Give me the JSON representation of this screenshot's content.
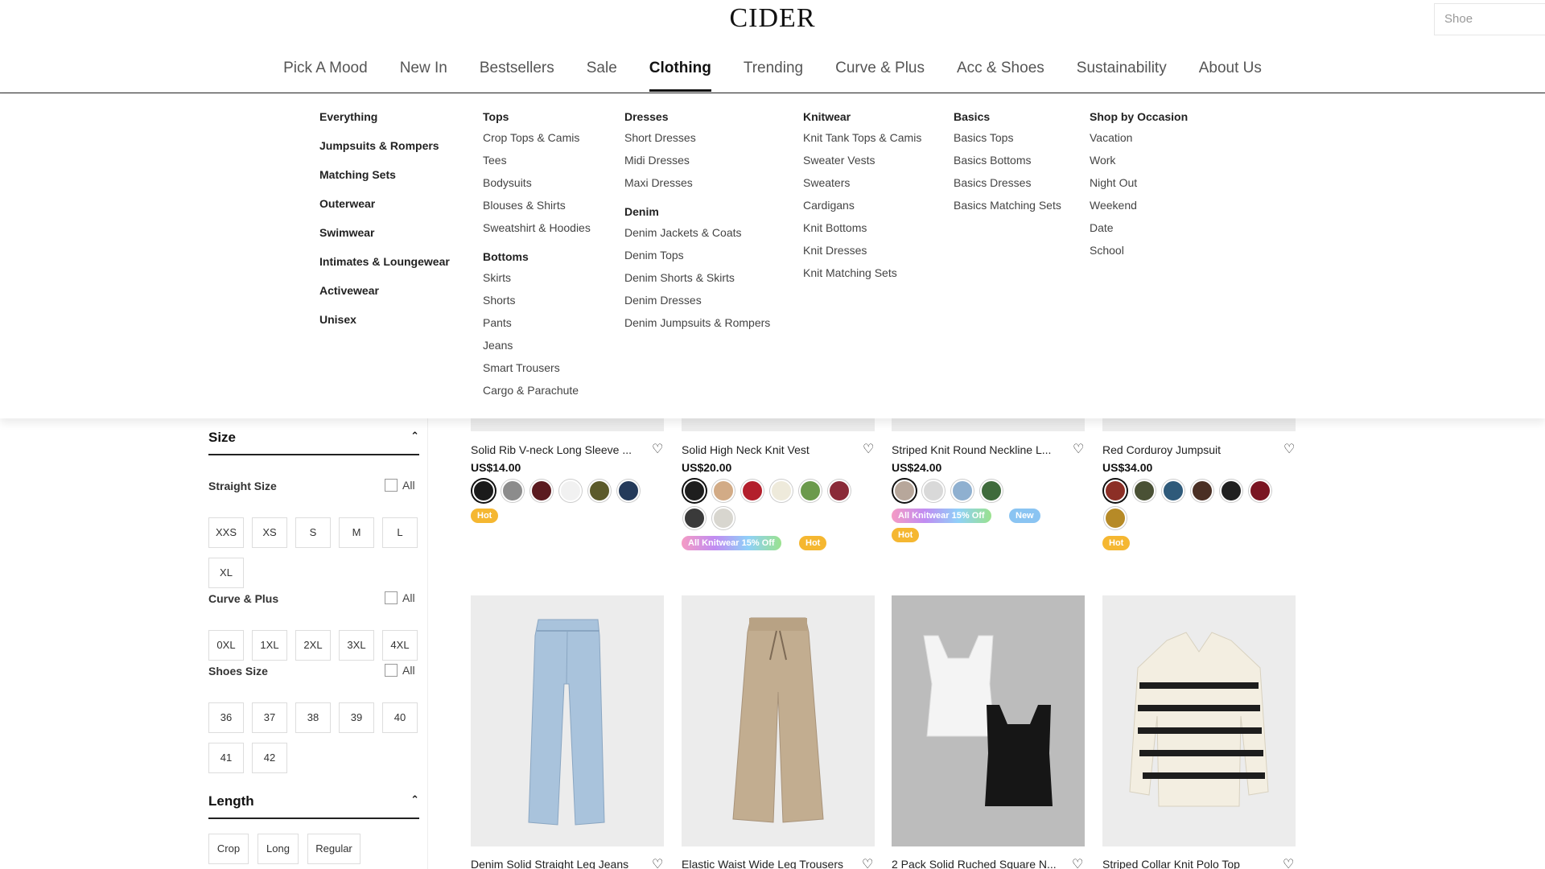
{
  "header": {
    "logo": "CIDER",
    "search_placeholder": "Shoe"
  },
  "nav": [
    {
      "label": "Pick A Mood"
    },
    {
      "label": "New In"
    },
    {
      "label": "Bestsellers"
    },
    {
      "label": "Sale"
    },
    {
      "label": "Clothing",
      "active": true
    },
    {
      "label": "Trending"
    },
    {
      "label": "Curve & Plus"
    },
    {
      "label": "Acc & Shoes"
    },
    {
      "label": "Sustainability"
    },
    {
      "label": "About Us"
    }
  ],
  "mega": {
    "main_links": [
      "Everything",
      "Jumpsuits & Rompers",
      "Matching Sets",
      "Outerwear",
      "Swimwear",
      "Intimates & Loungewear",
      "Activewear",
      "Unisex"
    ],
    "tops": {
      "title": "Tops",
      "items": [
        "Crop Tops & Camis",
        "Tees",
        "Bodysuits",
        "Blouses & Shirts",
        "Sweatshirt & Hoodies"
      ]
    },
    "bottoms": {
      "title": "Bottoms",
      "items": [
        "Skirts",
        "Shorts",
        "Pants",
        "Jeans",
        "Smart Trousers",
        "Cargo & Parachute"
      ]
    },
    "dresses": {
      "title": "Dresses",
      "items": [
        "Short Dresses",
        "Midi Dresses",
        "Maxi Dresses"
      ]
    },
    "denim": {
      "title": "Denim",
      "items": [
        "Denim Jackets & Coats",
        "Denim Tops",
        "Denim Shorts & Skirts",
        "Denim Dresses",
        "Denim Jumpsuits & Rompers"
      ]
    },
    "knitwear": {
      "title": "Knitwear",
      "items": [
        "Knit Tank Tops & Camis",
        "Sweater Vests",
        "Sweaters",
        "Cardigans",
        "Knit Bottoms",
        "Knit Dresses",
        "Knit Matching Sets"
      ]
    },
    "basics": {
      "title": "Basics",
      "items": [
        "Basics Tops",
        "Basics Bottoms",
        "Basics Dresses",
        "Basics Matching Sets"
      ]
    },
    "occasion": {
      "title": "Shop by Occasion",
      "items": [
        "Vacation",
        "Work",
        "Night Out",
        "Weekend",
        "Date",
        "School"
      ]
    }
  },
  "filters": {
    "size_title": "Size",
    "straight_label": "Straight Size",
    "straight_sizes": [
      "XXS",
      "XS",
      "S",
      "M",
      "L",
      "XL"
    ],
    "curve_label": "Curve & Plus",
    "curve_sizes": [
      "0XL",
      "1XL",
      "2XL",
      "3XL",
      "4XL"
    ],
    "shoes_label": "Shoes Size",
    "shoe_sizes": [
      "36",
      "37",
      "38",
      "39",
      "40",
      "41",
      "42"
    ],
    "all_label": "All",
    "length_title": "Length",
    "lengths": [
      "Crop",
      "Long",
      "Regular"
    ],
    "caret": "⌃"
  },
  "products_row1": [
    {
      "title": "Solid Rib V-neck Long Sleeve ...",
      "price": "US$14.00",
      "swatches": [
        "#1b1b1b",
        "#8c8c8c",
        "#5a1a1f",
        "#f1f1f1",
        "#5b5a2a",
        "#243a5a"
      ],
      "badges": [
        {
          "type": "hot",
          "text": "Hot"
        }
      ]
    },
    {
      "title": "Solid High Neck Knit Vest",
      "price": "US$20.00",
      "swatches": [
        "#1e1e1e",
        "#d2ab86",
        "#b31f2c",
        "#eeeadb",
        "#6b9a4c",
        "#8a2a38",
        "#3a3a3a",
        "#d8d6cf"
      ],
      "badges": [
        {
          "type": "knit",
          "text": "All Knitwear 15% Off"
        },
        {
          "type": "hot",
          "text": "Hot"
        }
      ]
    },
    {
      "title": "Striped Knit Round Neckline L...",
      "price": "US$24.00",
      "swatches": [
        "#b7a79b",
        "#d9d9d9",
        "#8fb0d0",
        "#3f6b3c"
      ],
      "badges": [
        {
          "type": "knit",
          "text": "All Knitwear 15% Off"
        },
        {
          "type": "new",
          "text": "New"
        },
        {
          "type": "hot",
          "text": "Hot"
        }
      ]
    },
    {
      "title": "Red Corduroy Jumpsuit",
      "price": "US$34.00",
      "swatches": [
        "#8c2f26",
        "#4a5135",
        "#2f5a7a",
        "#4a2f24",
        "#202020",
        "#7a1522",
        "#b68a27"
      ],
      "badges": [
        {
          "type": "hot",
          "text": "Hot"
        }
      ]
    }
  ],
  "products_row2": [
    {
      "title": "Denim Solid Straight Leg Jeans"
    },
    {
      "title": "Elastic Waist Wide Leg Trousers"
    },
    {
      "title": "2 Pack Solid Ruched Square N..."
    },
    {
      "title": "Striped Collar Knit Polo Top"
    }
  ],
  "icons": {
    "heart": "♡"
  }
}
